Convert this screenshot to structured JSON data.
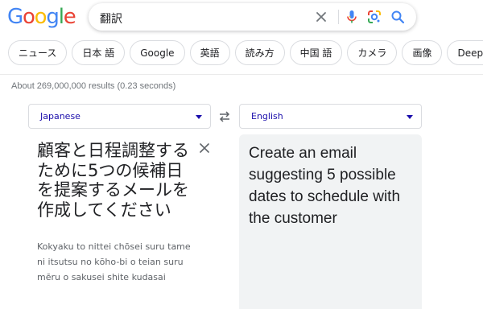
{
  "logo": {
    "letters": [
      {
        "char": "G",
        "color": "#4285F4"
      },
      {
        "char": "o",
        "color": "#EA4335"
      },
      {
        "char": "o",
        "color": "#FBBC05"
      },
      {
        "char": "g",
        "color": "#4285F4"
      },
      {
        "char": "l",
        "color": "#34A853"
      },
      {
        "char": "e",
        "color": "#EA4335"
      }
    ]
  },
  "search": {
    "query": "翻訳",
    "icons": [
      "clear-icon",
      "microphone-icon",
      "google-lens-icon",
      "search-icon"
    ]
  },
  "chips": [
    "ニュース",
    "日本 語",
    "Google",
    "英語",
    "読み方",
    "中国 語",
    "カメラ",
    "画像",
    "Deepl"
  ],
  "results_stats": "About 269,000,000 results (0.23 seconds)",
  "translator": {
    "source_lang": "Japanese",
    "target_lang": "English",
    "source_text": "顧客と日程調整するために5つの候補日を提案するメールを作成してください",
    "romanization": "Kokyaku to nittei chōsei suru tame ni itsutsu no kōho-bi o teian suru mēru o sakusei shite kudasai",
    "target_text": "Create an email suggesting 5 possible dates to schedule with the customer"
  },
  "colors": {
    "blue": "#4285F4",
    "red": "#EA4335",
    "yellow": "#FBBC05",
    "green": "#34A853",
    "link_blue": "#1a0dab"
  }
}
